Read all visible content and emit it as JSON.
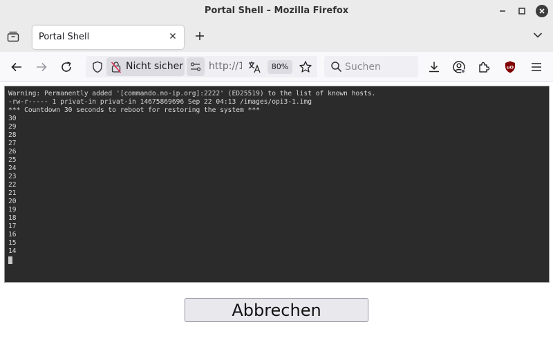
{
  "window": {
    "title": "Portal Shell – Mozilla Firefox"
  },
  "tabs": [
    {
      "label": "Portal Shell",
      "active": true
    }
  ],
  "navbar": {
    "security_label": "Nicht sicher",
    "url": "http://1",
    "zoom": "80%",
    "search_placeholder": "Suchen"
  },
  "terminal": {
    "lines": [
      "Warning: Permanently added '[commando.no-ip.org]:2222' (ED25519) to the list of known hosts.",
      "-rw-r----- 1 privat-in privat-in 14675869696 Sep 22 04:13 /images/opi3-1.img",
      "*** Countdown 30 seconds to reboot for restoring the system ***",
      "30",
      "29",
      "28",
      "27",
      "26",
      "25",
      "24",
      "23",
      "22",
      "21",
      "20",
      "19",
      "18",
      "17",
      "16",
      "15",
      "14"
    ]
  },
  "actions": {
    "cancel_label": "Abbrechen"
  },
  "colors": {
    "terminal_bg": "#2b2b2b",
    "terminal_fg": "#d9d9d9",
    "chrome_bg": "#ebebeb",
    "ublock_red": "#800000"
  }
}
